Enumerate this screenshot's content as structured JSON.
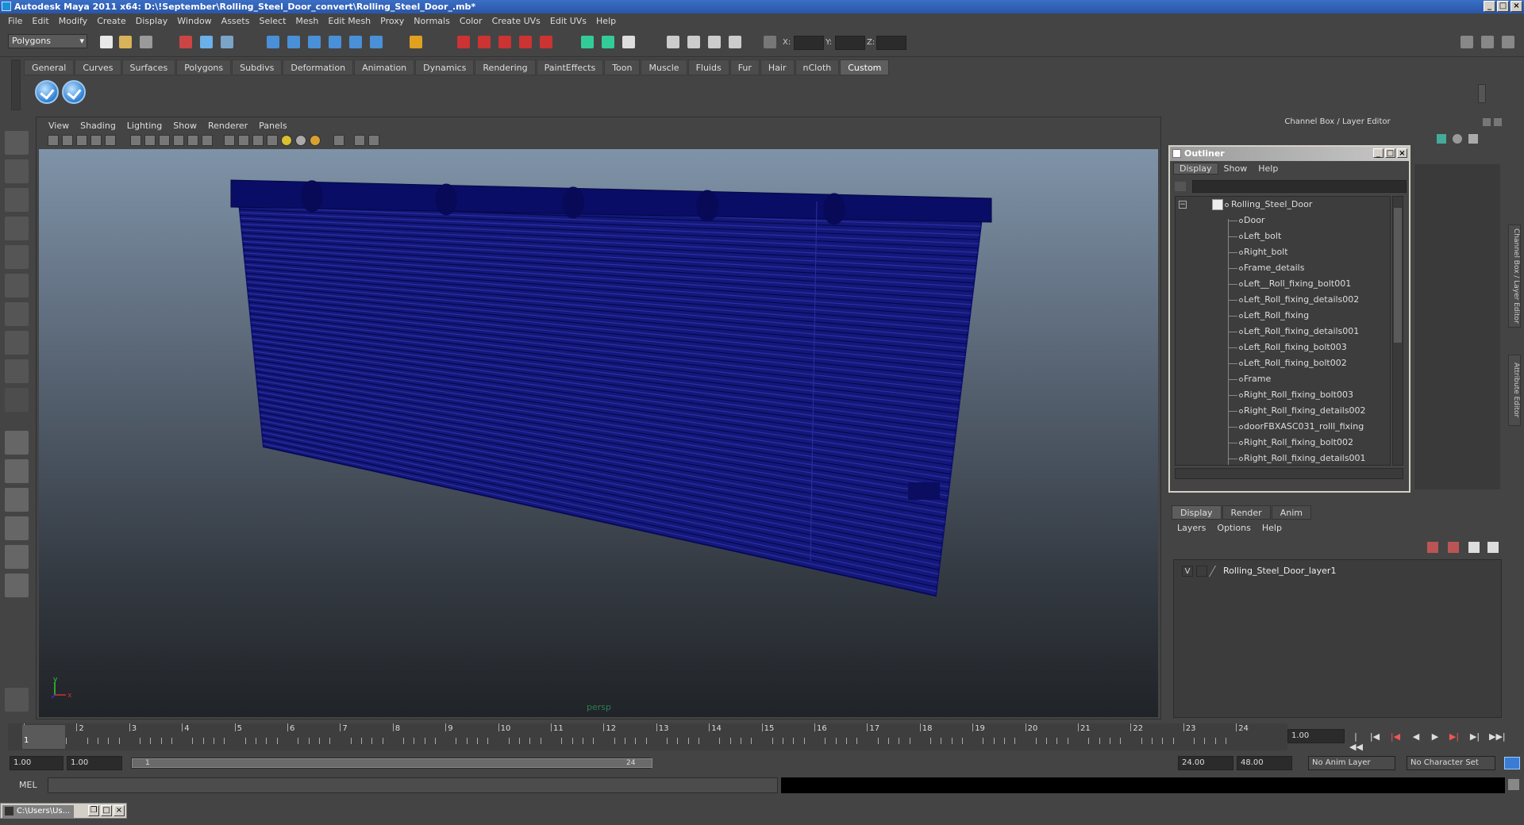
{
  "title": "Autodesk Maya 2011 x64: D:\\!September\\Rolling_Steel_Door_convert\\Rolling_Steel_Door_.mb*",
  "menubar": [
    "File",
    "Edit",
    "Modify",
    "Create",
    "Display",
    "Window",
    "Assets",
    "Select",
    "Mesh",
    "Edit Mesh",
    "Proxy",
    "Normals",
    "Color",
    "Create UVs",
    "Edit UVs",
    "Help"
  ],
  "status": {
    "mode": "Polygons",
    "x_label": "X:",
    "y_label": "Y:",
    "z_label": "Z:"
  },
  "shelf_tabs": [
    "General",
    "Curves",
    "Surfaces",
    "Polygons",
    "Subdivs",
    "Deformation",
    "Animation",
    "Dynamics",
    "Rendering",
    "PaintEffects",
    "Toon",
    "Muscle",
    "Fluids",
    "Fur",
    "Hair",
    "nCloth",
    "Custom"
  ],
  "shelf_active": "Custom",
  "viewport": {
    "menus": [
      "View",
      "Shading",
      "Lighting",
      "Show",
      "Renderer",
      "Panels"
    ],
    "camera": "persp",
    "axis_x": "x",
    "axis_y": "y",
    "mesh_color": "#0c0f6b"
  },
  "right_panel": {
    "header": "Channel Box / Layer Editor",
    "side_tabs": [
      "Channel Box / Layer Editor",
      "Attribute Editor"
    ]
  },
  "outliner": {
    "title": "Outliner",
    "menus": [
      "Display",
      "Show",
      "Help"
    ],
    "root": "Rolling_Steel_Door",
    "items": [
      "Door",
      "Left_bolt",
      "Right_bolt",
      "Frame_details",
      "Left__Roll_fixing_bolt001",
      "Left_Roll_fixing_details002",
      "Left_Roll_fixing",
      "Left_Roll_fixing_details001",
      "Left_Roll_fixing_bolt003",
      "Left_Roll_fixing_bolt002",
      "Frame",
      "Right_Roll_fixing_bolt003",
      "Right_Roll_fixing_details002",
      "doorFBXASC031_rolll_fixing",
      "Right_Roll_fixing_bolt002",
      "Right_Roll_fixing_details001"
    ]
  },
  "layer_editor": {
    "tabs": [
      "Display",
      "Render",
      "Anim"
    ],
    "menus": [
      "Layers",
      "Options",
      "Help"
    ],
    "layer_visible": "V",
    "layer_name": "Rolling_Steel_Door_layer1"
  },
  "timeline": {
    "ticks": [
      "1",
      "2",
      "3",
      "4",
      "5",
      "6",
      "7",
      "8",
      "9",
      "10",
      "11",
      "12",
      "13",
      "14",
      "15",
      "16",
      "17",
      "18",
      "19",
      "20",
      "21",
      "22",
      "23",
      "24"
    ],
    "current_marker": "1",
    "current_frame": "1.00"
  },
  "range": {
    "start": "1.00",
    "playback_start": "1.00",
    "slider_start": "1",
    "slider_end": "24",
    "playback_end": "24.00",
    "end": "48.00",
    "anim_layer": "No Anim Layer",
    "character_set": "No Character Set"
  },
  "cmdline": {
    "label": "MEL"
  },
  "taskbar": {
    "title": "C:\\Users\\Us..."
  }
}
